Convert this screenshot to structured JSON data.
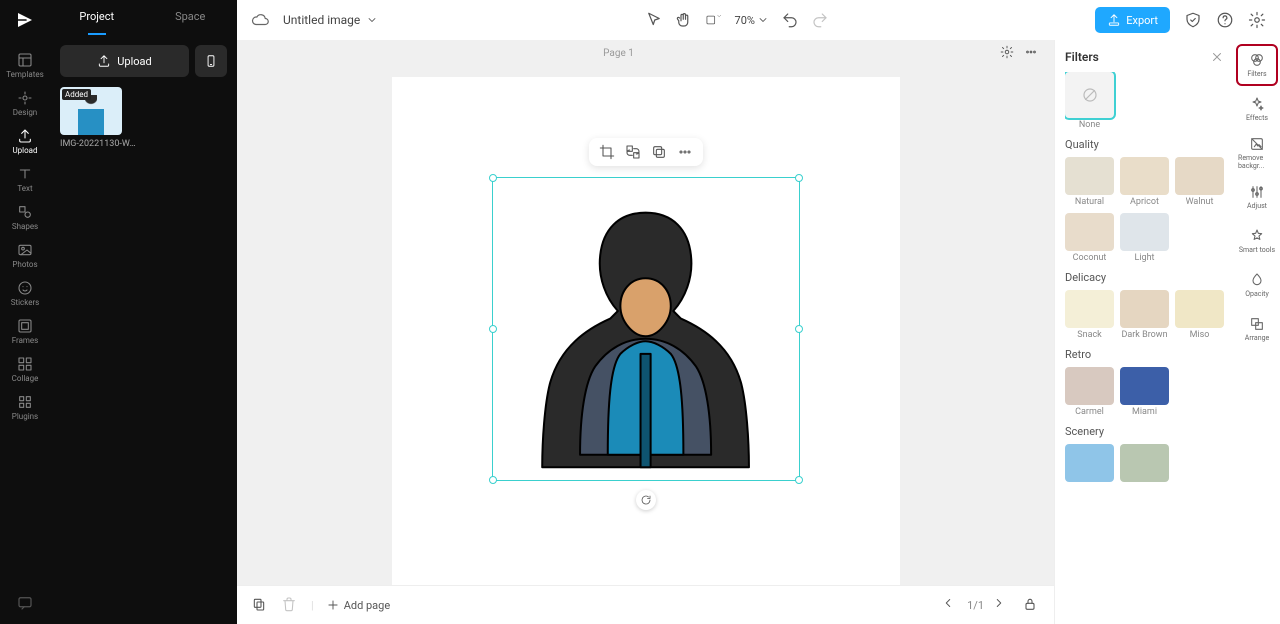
{
  "rail": [
    {
      "label": "Templates",
      "icon": "templates"
    },
    {
      "label": "Design",
      "icon": "design"
    },
    {
      "label": "Upload",
      "icon": "upload",
      "active": true
    },
    {
      "label": "Text",
      "icon": "text"
    },
    {
      "label": "Shapes",
      "icon": "shapes"
    },
    {
      "label": "Photos",
      "icon": "photos"
    },
    {
      "label": "Stickers",
      "icon": "stickers"
    },
    {
      "label": "Frames",
      "icon": "frames"
    },
    {
      "label": "Collage",
      "icon": "collage"
    },
    {
      "label": "Plugins",
      "icon": "plugins"
    }
  ],
  "sidebar": {
    "tabs": [
      {
        "label": "Project",
        "active": true
      },
      {
        "label": "Space",
        "active": false
      }
    ],
    "upload_label": "Upload",
    "asset_badge": "Added",
    "asset_name": "IMG-20221130-WA0..."
  },
  "topbar": {
    "title": "Untitled image",
    "zoom": "70%",
    "export_label": "Export"
  },
  "page_strip": {
    "label": "Page 1"
  },
  "bottombar": {
    "add_page": "Add page",
    "pager": "1/1"
  },
  "filters": {
    "title": "Filters",
    "none_label": "None",
    "groups": [
      {
        "title": "Quality",
        "items": [
          {
            "label": "Natural",
            "bg": "#e5e0d2"
          },
          {
            "label": "Apricot",
            "bg": "#e9ddc9"
          },
          {
            "label": "Walnut",
            "bg": "#e6d9c6"
          },
          {
            "label": "Coconut",
            "bg": "#e8dccb"
          },
          {
            "label": "Light",
            "bg": "#dfe5ea"
          }
        ]
      },
      {
        "title": "Delicacy",
        "items": [
          {
            "label": "Snack",
            "bg": "#f4efd7"
          },
          {
            "label": "Dark Brown",
            "bg": "#e5d6c1"
          },
          {
            "label": "Miso",
            "bg": "#f0e7c6"
          }
        ]
      },
      {
        "title": "Retro",
        "items": [
          {
            "label": "Carmel",
            "bg": "#d8c9c0"
          },
          {
            "label": "Miami",
            "bg": "#3c5fa8"
          }
        ]
      },
      {
        "title": "Scenery",
        "items": [
          {
            "label": "",
            "bg": "#8fc5e8"
          },
          {
            "label": "",
            "bg": "#b9c7b1"
          }
        ]
      }
    ]
  },
  "toolrail": [
    {
      "label": "Filters",
      "icon": "filters",
      "highlight": true
    },
    {
      "label": "Effects",
      "icon": "effects"
    },
    {
      "label": "Remove backgr...",
      "icon": "remove-bg"
    },
    {
      "label": "Adjust",
      "icon": "adjust"
    },
    {
      "label": "Smart tools",
      "icon": "smart"
    },
    {
      "label": "Opacity",
      "icon": "opacity"
    },
    {
      "label": "Arrange",
      "icon": "arrange"
    }
  ]
}
